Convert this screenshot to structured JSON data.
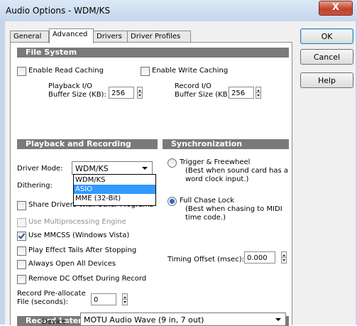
{
  "window": {
    "title": "Audio Options - WDM/KS",
    "close_glyph": "X"
  },
  "tabs": [
    "General",
    "Advanced",
    "Drivers",
    "Driver Profiles"
  ],
  "buttons": {
    "ok": "OK",
    "cancel": "Cancel",
    "help": "Help"
  },
  "file_system": {
    "header": "File System",
    "enable_read_caching": "Enable Read Caching",
    "enable_write_caching": "Enable Write Caching",
    "playback_label_1": "Playback I/O",
    "playback_label_2": "Buffer Size (KB):",
    "playback_value": "256",
    "record_label_1": "Record I/O",
    "record_label_2": "Buffer Size (KB):",
    "record_value": "256"
  },
  "playback": {
    "header": "Playback and Recording",
    "driver_mode_label": "Driver Mode:",
    "driver_mode_value": "WDM/KS",
    "driver_mode_options": [
      "WDM/KS",
      "ASIO",
      "MME (32-Bit)"
    ],
    "dithering_label": "Dithering:",
    "share_drivers": "Share Drivers With Other Programs",
    "use_multiprocessing": "Use Multiprocessing Engine",
    "use_mmcss": "Use MMCSS (Windows Vista)",
    "play_effect_tails": "Play Effect Tails After Stopping",
    "always_open": "Always Open All Devices",
    "remove_dc": "Remove DC Offset During Record",
    "preallocate_1": "Record Pre-allocate",
    "preallocate_2": "File (seconds):",
    "preallocate_value": "0"
  },
  "sync": {
    "header": "Synchronization",
    "trigger_label": "Trigger & Freewheel",
    "trigger_desc_1": "(Best when sound card has a",
    "trigger_desc_2": "word clock input.)",
    "full_chase_label": "Full Chase Lock",
    "full_chase_desc_1": "(Best when chasing to MIDI",
    "full_chase_desc_2": "time code.)",
    "timing_offset_label": "Timing Offset (msec):",
    "timing_offset_value": "0.000"
  },
  "latency": {
    "header": "Record Latency Adjustment (samples)",
    "device_label": "Device:",
    "device_value": "MOTU Audio Wave (9 in, 7 out)"
  }
}
